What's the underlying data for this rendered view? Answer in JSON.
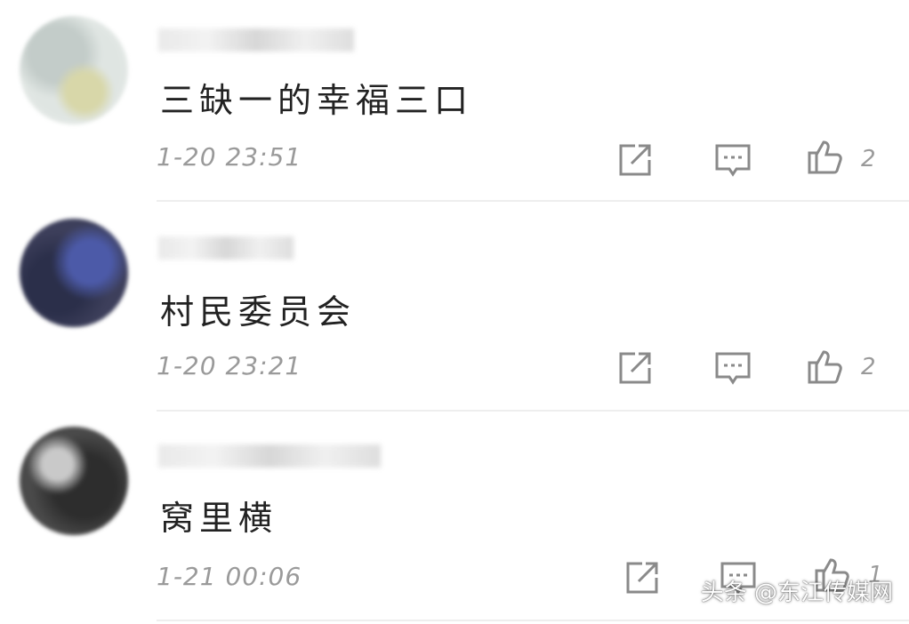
{
  "comments": [
    {
      "text": "三缺一的幸福三口",
      "time": "1-20 23:51",
      "likes": "2"
    },
    {
      "text": "村民委员会",
      "time": "1-20 23:21",
      "likes": "2"
    },
    {
      "text": "窝里横",
      "time": "1-21 00:06",
      "likes": "1"
    }
  ],
  "icons": {
    "share": "share-icon",
    "reply": "comment-icon",
    "like": "thumbs-up-icon"
  },
  "watermark": "头条 @东江传媒网",
  "colors": {
    "text": "#222222",
    "meta": "#9a9a9a",
    "icon": "#8a8a8a",
    "divider": "#eeeeee"
  }
}
